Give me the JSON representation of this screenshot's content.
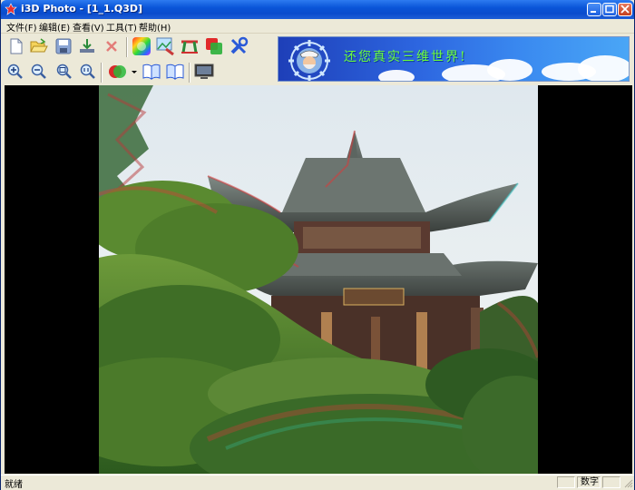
{
  "window": {
    "title": "i3D Photo - [1_1.Q3D]"
  },
  "menu": {
    "items": [
      {
        "label": "文件(F)"
      },
      {
        "label": "编辑(E)"
      },
      {
        "label": "查看(V)"
      },
      {
        "label": "工具(T)"
      },
      {
        "label": "帮助(H)"
      }
    ]
  },
  "toolbar": {
    "row1": [
      "new-icon",
      "open-icon",
      "save-icon",
      "import-icon",
      "delete-icon",
      "color-adjust-icon",
      "image-tool-icon",
      "align-icon",
      "layers-icon",
      "tools-icon"
    ],
    "row2": [
      "zoom-in-icon",
      "zoom-out-icon",
      "zoom-fit-icon",
      "zoom-actual-icon",
      "anaglyph-icon",
      "dropdown-arrow-icon",
      "book-left-icon",
      "book-right-icon",
      "display-icon"
    ]
  },
  "banner": {
    "text": "还您真实三维世界!"
  },
  "statusbar": {
    "status": "就绪",
    "num_indicator": "数字"
  },
  "colors": {
    "titlebar": "#0a55d8",
    "chrome": "#ece9d8",
    "viewport": "#000000"
  }
}
